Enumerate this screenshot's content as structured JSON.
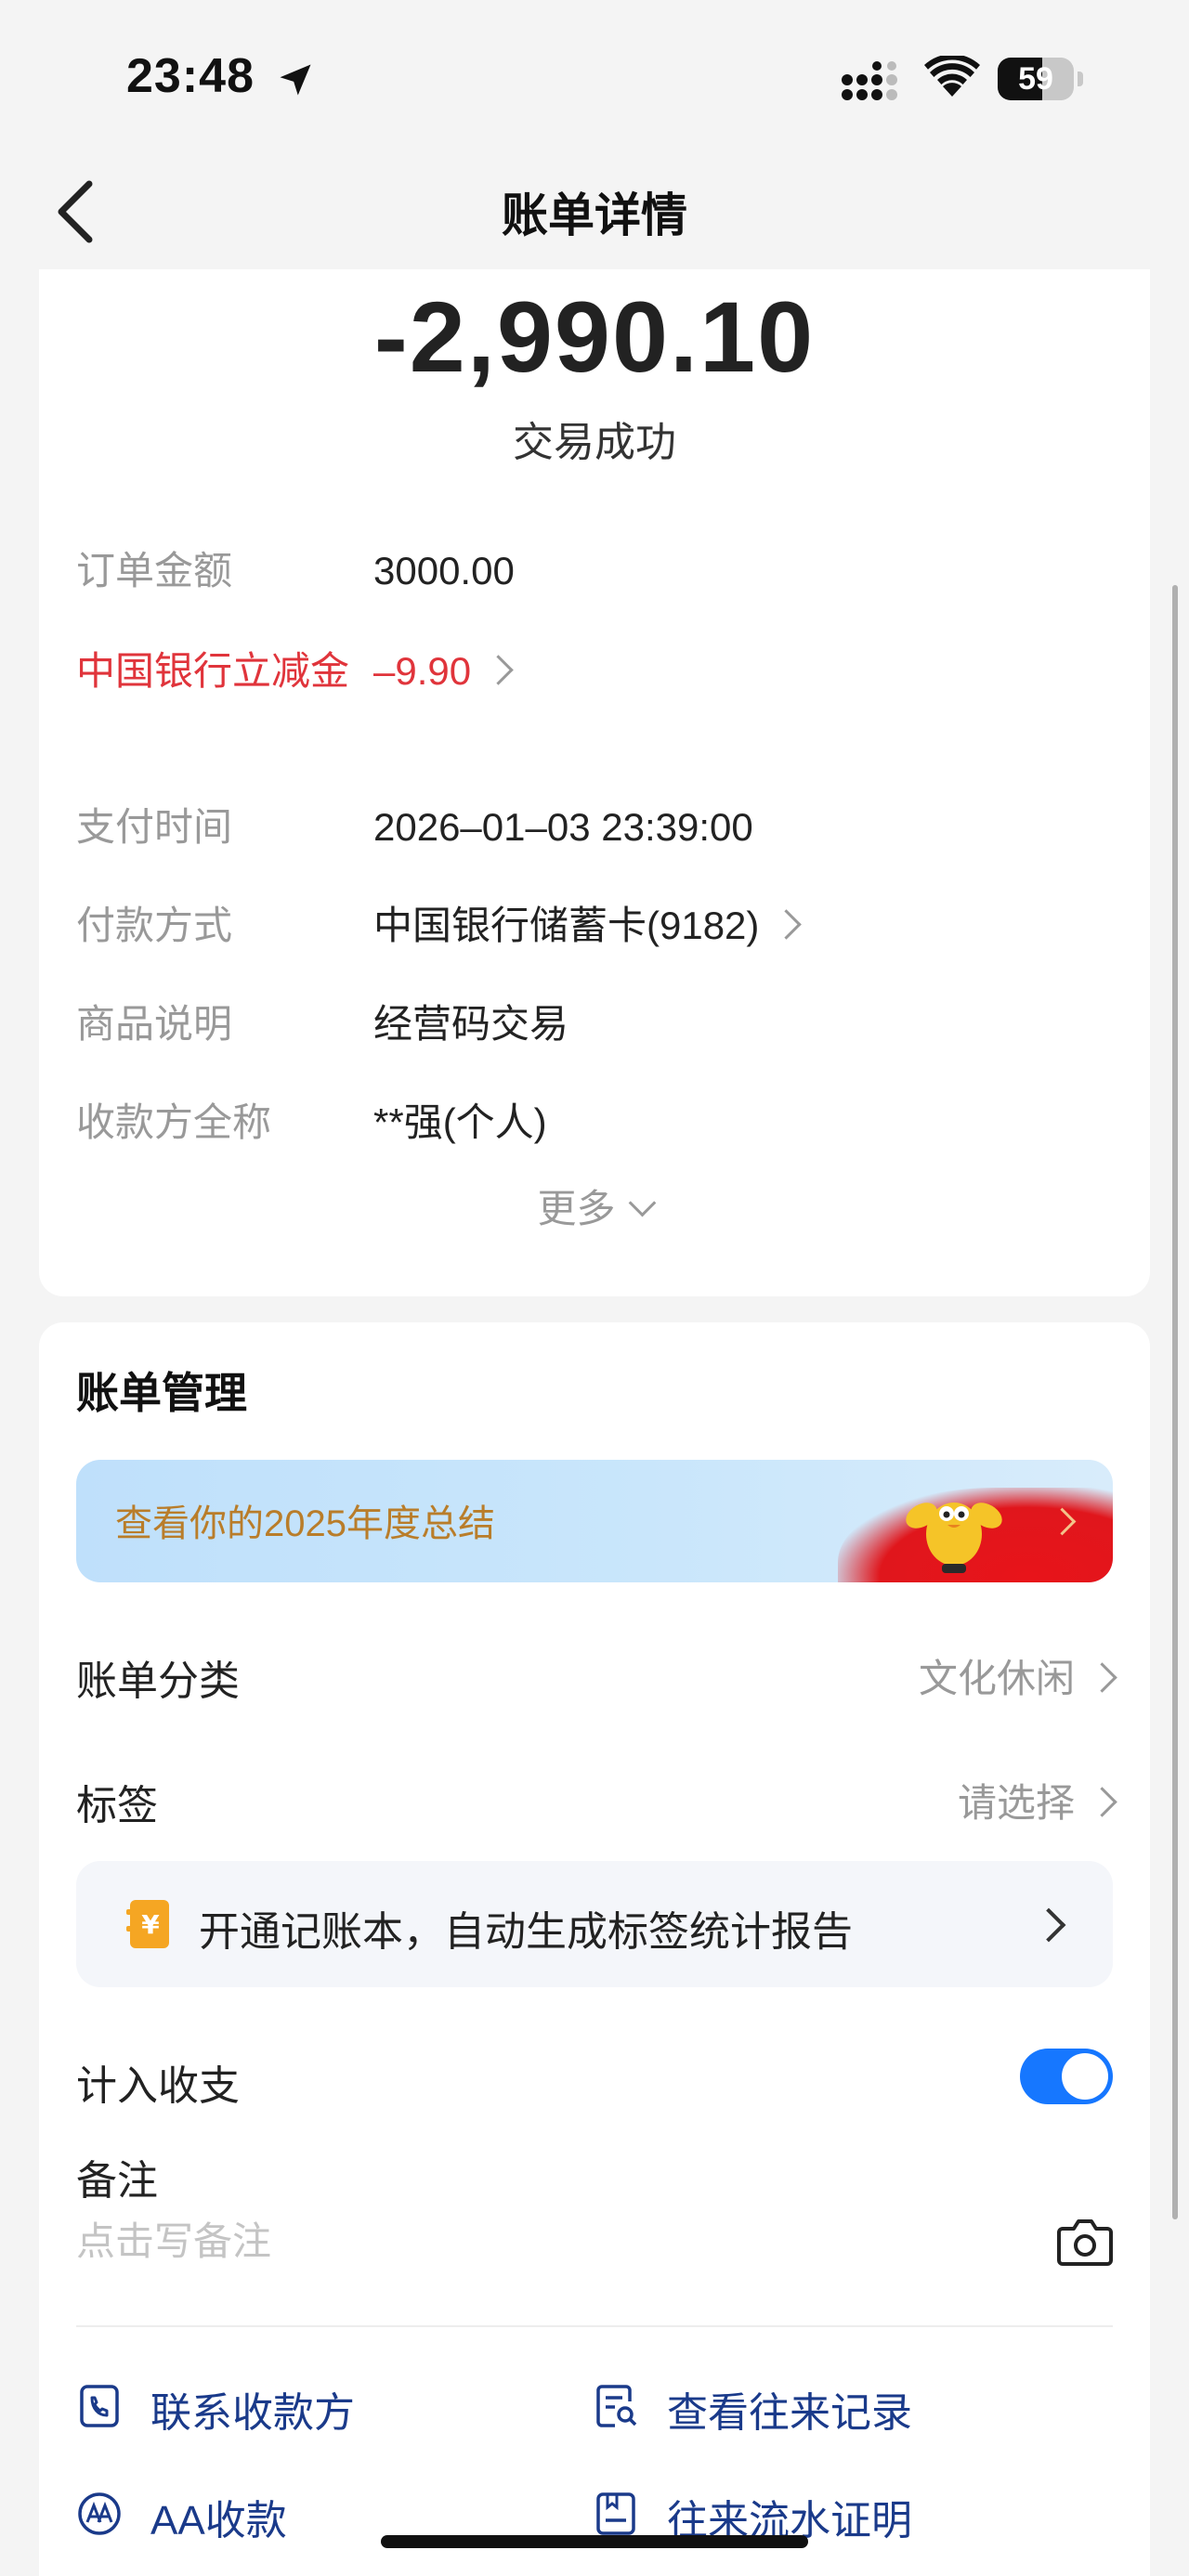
{
  "status_bar": {
    "time": "23:48",
    "battery": "59",
    "battery_level": 0.59
  },
  "nav": {
    "title": "账单详情"
  },
  "summary": {
    "amount": "-2,990.10",
    "status": "交易成功"
  },
  "details": {
    "order_amount_label": "订单金额",
    "order_amount_value": "3000.00",
    "discount_label": "中国银行立减金",
    "discount_value": "–9.90",
    "pay_time_label": "支付时间",
    "pay_time_value": "2026–01–03 23:39:00",
    "pay_method_label": "付款方式",
    "pay_method_value": "中国银行储蓄卡(9182)",
    "goods_label": "商品说明",
    "goods_value": "经营码交易",
    "payee_label": "收款方全称",
    "payee_value": "**强(个人)",
    "more_label": "更多"
  },
  "manage": {
    "title": "账单管理",
    "banner_text": "查看你的2025年度总结",
    "category_label": "账单分类",
    "category_value": "文化休闲",
    "tag_label": "标签",
    "tag_value": "请选择",
    "promo_text": "开通记账本，自动生成标签统计报告",
    "promo_icon_glyph": "¥",
    "include_label": "计入收支",
    "include_enabled": true,
    "note_label": "备注",
    "note_placeholder": "点击写备注",
    "actions": {
      "contact_payee": "联系收款方",
      "view_records": "查看往来记录",
      "aa_collect": "AA收款",
      "statement_proof": "往来流水证明"
    }
  },
  "colors": {
    "accent": "#1677ff",
    "discount_red": "#e0343b",
    "action_text": "#1a3a8a",
    "banner_text": "#b97d2a"
  }
}
